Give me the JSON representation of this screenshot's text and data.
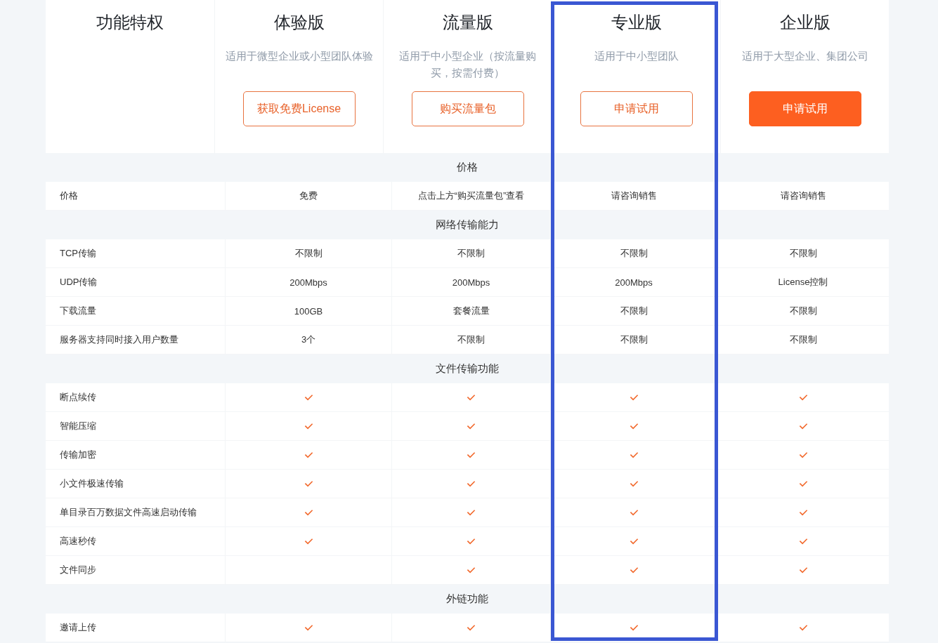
{
  "header": {
    "label": "功能特权"
  },
  "plans": [
    {
      "name": "体验版",
      "description": "适用于微型企业或小型团队体验",
      "button": {
        "label": "获取免费License",
        "kind": "outline"
      },
      "highlighted": false
    },
    {
      "name": "流量版",
      "description": "适用于中小型企业（按流量购买，按需付费）",
      "button": {
        "label": "购买流量包",
        "kind": "outline"
      },
      "highlighted": false
    },
    {
      "name": "专业版",
      "description": "适用于中小型团队",
      "button": {
        "label": "申请试用",
        "kind": "outline"
      },
      "highlighted": true
    },
    {
      "name": "企业版",
      "description": "适用于大型企业、集团公司",
      "button": {
        "label": "申请试用",
        "kind": "filled"
      },
      "highlighted": false
    }
  ],
  "sections": [
    {
      "title": "价格",
      "rows": [
        {
          "feature": "价格",
          "cells": [
            {
              "kind": "text",
              "text": "免费"
            },
            {
              "kind": "text",
              "text": "点击上方“购买流量包”查看"
            },
            {
              "kind": "text",
              "text": "请咨询销售"
            },
            {
              "kind": "text",
              "text": "请咨询销售"
            }
          ]
        }
      ]
    },
    {
      "title": "网络传输能力",
      "rows": [
        {
          "feature": "TCP传输",
          "cells": [
            {
              "kind": "text",
              "text": "不限制"
            },
            {
              "kind": "text",
              "text": "不限制"
            },
            {
              "kind": "text",
              "text": "不限制"
            },
            {
              "kind": "text",
              "text": "不限制"
            }
          ]
        },
        {
          "feature": "UDP传输",
          "cells": [
            {
              "kind": "text",
              "text": "200Mbps"
            },
            {
              "kind": "text",
              "text": "200Mbps"
            },
            {
              "kind": "text",
              "text": "200Mbps"
            },
            {
              "kind": "text",
              "text": "License控制"
            }
          ]
        },
        {
          "feature": "下载流量",
          "cells": [
            {
              "kind": "text",
              "text": "100GB"
            },
            {
              "kind": "text",
              "text": "套餐流量"
            },
            {
              "kind": "text",
              "text": "不限制"
            },
            {
              "kind": "text",
              "text": "不限制"
            }
          ]
        },
        {
          "feature": "服务器支持同时接入用户数量",
          "cells": [
            {
              "kind": "text",
              "text": "3个"
            },
            {
              "kind": "text",
              "text": "不限制"
            },
            {
              "kind": "text",
              "text": "不限制"
            },
            {
              "kind": "text",
              "text": "不限制"
            }
          ]
        }
      ]
    },
    {
      "title": "文件传输功能",
      "rows": [
        {
          "feature": "断点续传",
          "cells": [
            {
              "kind": "check",
              "checked": true
            },
            {
              "kind": "check",
              "checked": true
            },
            {
              "kind": "check",
              "checked": true
            },
            {
              "kind": "check",
              "checked": true
            }
          ]
        },
        {
          "feature": "智能压缩",
          "cells": [
            {
              "kind": "check",
              "checked": true
            },
            {
              "kind": "check",
              "checked": true
            },
            {
              "kind": "check",
              "checked": true
            },
            {
              "kind": "check",
              "checked": true
            }
          ]
        },
        {
          "feature": "传输加密",
          "cells": [
            {
              "kind": "check",
              "checked": true
            },
            {
              "kind": "check",
              "checked": true
            },
            {
              "kind": "check",
              "checked": true
            },
            {
              "kind": "check",
              "checked": true
            }
          ]
        },
        {
          "feature": "小文件极速传输",
          "cells": [
            {
              "kind": "check",
              "checked": true
            },
            {
              "kind": "check",
              "checked": true
            },
            {
              "kind": "check",
              "checked": true
            },
            {
              "kind": "check",
              "checked": true
            }
          ]
        },
        {
          "feature": "单目录百万数据文件高速启动传输",
          "cells": [
            {
              "kind": "check",
              "checked": true
            },
            {
              "kind": "check",
              "checked": true
            },
            {
              "kind": "check",
              "checked": true
            },
            {
              "kind": "check",
              "checked": true
            }
          ]
        },
        {
          "feature": "高速秒传",
          "cells": [
            {
              "kind": "check",
              "checked": true
            },
            {
              "kind": "check",
              "checked": true
            },
            {
              "kind": "check",
              "checked": true
            },
            {
              "kind": "check",
              "checked": true
            }
          ]
        },
        {
          "feature": "文件同步",
          "cells": [
            {
              "kind": "check",
              "checked": false
            },
            {
              "kind": "check",
              "checked": true
            },
            {
              "kind": "check",
              "checked": true
            },
            {
              "kind": "check",
              "checked": true
            }
          ]
        }
      ]
    },
    {
      "title": "外链功能",
      "rows": [
        {
          "feature": "邀请上传",
          "cells": [
            {
              "kind": "check",
              "checked": true
            },
            {
              "kind": "check",
              "checked": true
            },
            {
              "kind": "check",
              "checked": true
            },
            {
              "kind": "check",
              "checked": true
            }
          ]
        }
      ]
    }
  ]
}
